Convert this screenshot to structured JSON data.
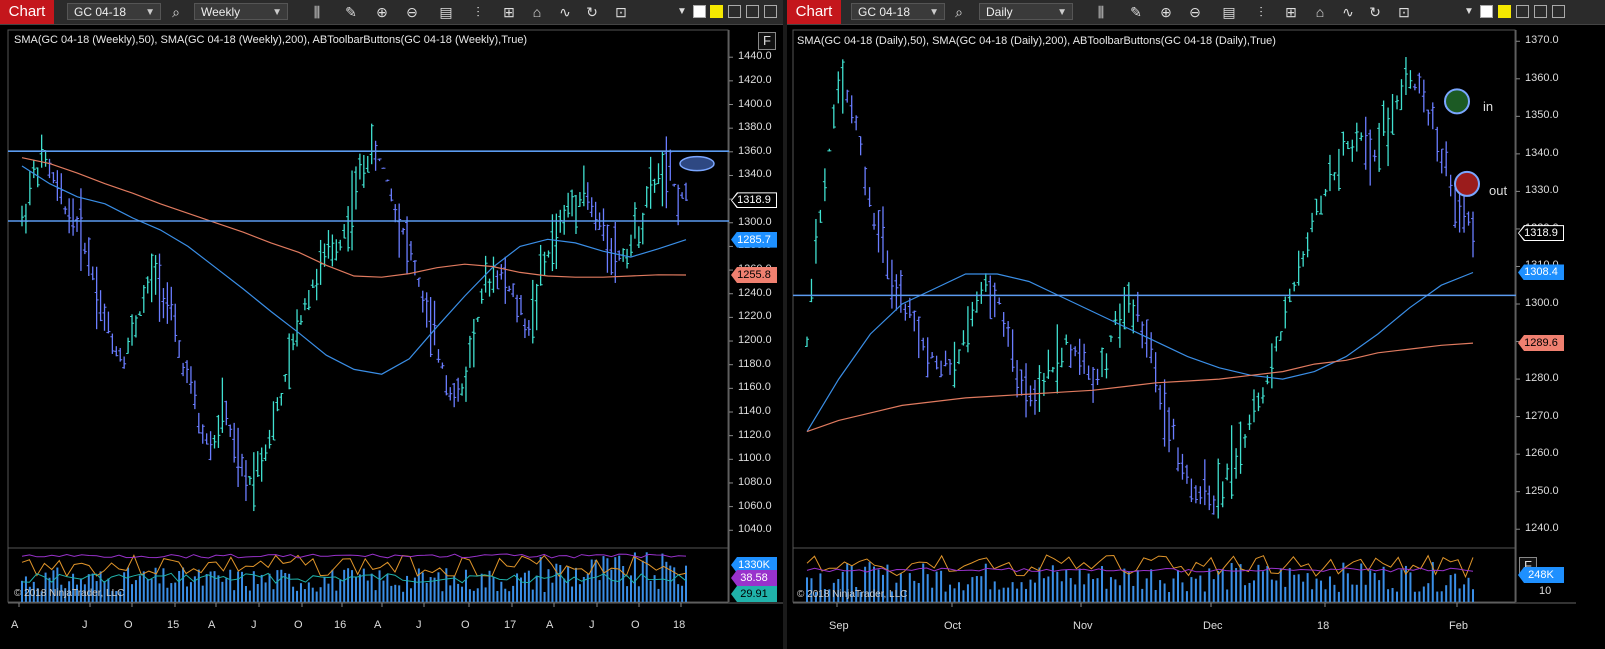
{
  "windows": [
    {
      "tab_label": "Chart",
      "instrument": "GC 04-18",
      "interval": "Weekly",
      "indicator_line": "SMA(GC 04-18 (Weekly),50), SMA(GC 04-18 (Weekly),200), ABToolbarButtons(GC 04-18 (Weekly),True)",
      "copyright": "© 2018 NinjaTrader, LLC",
      "f_label": "F",
      "price_ticks": [
        "1440.0",
        "1420.0",
        "1400.0",
        "1380.0",
        "1360.0",
        "1340.0",
        "1320.0",
        "1300.0",
        "1280.0",
        "1260.0",
        "1240.0",
        "1220.0",
        "1200.0",
        "1180.0",
        "1160.0",
        "1140.0",
        "1120.0",
        "1100.0",
        "1080.0",
        "1060.0",
        "1040.0"
      ],
      "date_ticks": [
        "A",
        "J",
        "O",
        "15",
        "A",
        "J",
        "O",
        "16",
        "A",
        "J",
        "O",
        "17",
        "A",
        "J",
        "O",
        "18"
      ],
      "price_badges": [
        {
          "text": "1318.9",
          "value": 1318.9,
          "bg": "#000000",
          "fg": "#ffffff",
          "border": "#ffffff"
        },
        {
          "text": "1285.7",
          "value": 1285.7,
          "bg": "#1e90ff",
          "fg": "#ffffff",
          "border": "#1e90ff"
        },
        {
          "text": "1255.8",
          "value": 1255.8,
          "bg": "#f08070",
          "fg": "#000000",
          "border": "#f08070"
        }
      ],
      "volume_badges": [
        {
          "text": "1330K",
          "bg": "#1e90ff",
          "fg": "#ffffff"
        },
        {
          "text": "38.58",
          "bg": "#9932cc",
          "fg": "#ffffff"
        },
        {
          "text": "29.91",
          "bg": "#20b2aa",
          "fg": "#000000"
        }
      ]
    },
    {
      "tab_label": "Chart",
      "instrument": "GC 04-18",
      "interval": "Daily",
      "indicator_line": "SMA(GC 04-18 (Daily),50), SMA(GC 04-18 (Daily),200), ABToolbarButtons(GC 04-18 (Daily),True)",
      "copyright": "© 2018 NinjaTrader, LLC",
      "f_label": "F",
      "price_ticks": [
        "1370.0",
        "1360.0",
        "1350.0",
        "1340.0",
        "1330.0",
        "1320.0",
        "1310.0",
        "1300.0",
        "1290.0",
        "1280.0",
        "1270.0",
        "1260.0",
        "1250.0",
        "1240.0"
      ],
      "date_ticks": [
        "Sep",
        "Oct",
        "Nov",
        "Dec",
        "18",
        "Feb"
      ],
      "price_badges": [
        {
          "text": "1318.9",
          "value": 1318.9,
          "bg": "#000000",
          "fg": "#ffffff",
          "border": "#ffffff"
        },
        {
          "text": "1308.4",
          "value": 1308.4,
          "bg": "#1e90ff",
          "fg": "#ffffff",
          "border": "#1e90ff"
        },
        {
          "text": "1289.6",
          "value": 1289.6,
          "bg": "#f08070",
          "fg": "#000000",
          "border": "#f08070"
        }
      ],
      "volume_badges": [
        {
          "text": "248K",
          "bg": "#1e90ff",
          "fg": "#ffffff"
        }
      ],
      "volume_tick": "10",
      "annotations": {
        "in": "in",
        "out": "out"
      }
    }
  ],
  "chart_data": [
    {
      "type": "line",
      "title": "GC 04-18 Weekly",
      "ylim": [
        1025,
        1463
      ],
      "horizontal_lines": [
        1360.5,
        1301.5
      ],
      "last_price": 1318.9,
      "series": [
        {
          "name": "SMA 50",
          "color": "#3a8ee6",
          "y": [
            1348,
            1333,
            1322,
            1316,
            1304,
            1294,
            1280,
            1262,
            1244,
            1225,
            1207,
            1188,
            1176,
            1172,
            1185,
            1212,
            1238,
            1262,
            1280,
            1286,
            1283,
            1276,
            1271,
            1278,
            1285.7
          ]
        },
        {
          "name": "SMA 200",
          "color": "#e07a5f",
          "y": [
            1355,
            1350,
            1342,
            1333,
            1325,
            1316,
            1308,
            1300,
            1292,
            1283,
            1275,
            1264,
            1255,
            1254,
            1257,
            1262,
            1265,
            1263,
            1258,
            1255,
            1254,
            1254,
            1255,
            1256,
            1255.8
          ]
        }
      ],
      "price_path": [
        1300,
        1340,
        1355,
        1330,
        1310,
        1300,
        1270,
        1230,
        1200,
        1185,
        1210,
        1240,
        1260,
        1230,
        1190,
        1160,
        1120,
        1110,
        1145,
        1100,
        1080,
        1095,
        1120,
        1150,
        1190,
        1230,
        1250,
        1270,
        1280,
        1300,
        1340,
        1360,
        1350,
        1320,
        1290,
        1260,
        1220,
        1190,
        1160,
        1150,
        1200,
        1240,
        1260,
        1250,
        1230,
        1210,
        1250,
        1280,
        1300,
        1320,
        1330,
        1300,
        1290,
        1270,
        1280,
        1300,
        1330,
        1345,
        1330,
        1318.9
      ]
    },
    {
      "type": "line",
      "title": "GC 04-18 Daily",
      "ylim": [
        1235,
        1373
      ],
      "horizontal_lines": [
        1302.3
      ],
      "markers": [
        {
          "label": "in",
          "y": 1354,
          "color": "#1c5a24"
        },
        {
          "label": "out",
          "y": 1332,
          "color": "#9b1c1c"
        }
      ],
      "last_price": 1318.9,
      "series": [
        {
          "name": "SMA 50",
          "color": "#3a8ee6",
          "y": [
            1266,
            1280,
            1292,
            1300,
            1304,
            1308,
            1308,
            1306,
            1302,
            1298,
            1294,
            1290,
            1286,
            1283,
            1281,
            1280,
            1282,
            1286,
            1292,
            1299,
            1305,
            1308.4
          ]
        },
        {
          "name": "SMA 200",
          "color": "#e07a5f",
          "y": [
            1266,
            1269,
            1271,
            1273,
            1274,
            1275,
            1275.5,
            1276,
            1276.5,
            1277,
            1278,
            1279,
            1279.5,
            1280,
            1281,
            1282,
            1284,
            1285,
            1287,
            1288,
            1289,
            1289.6
          ]
        }
      ],
      "price_path": [
        1290,
        1330,
        1360,
        1350,
        1325,
        1310,
        1300,
        1290,
        1285,
        1282,
        1295,
        1305,
        1300,
        1280,
        1275,
        1282,
        1290,
        1285,
        1280,
        1295,
        1300,
        1290,
        1270,
        1260,
        1250,
        1245,
        1255,
        1265,
        1275,
        1290,
        1305,
        1320,
        1330,
        1340,
        1345,
        1340,
        1350,
        1360,
        1355,
        1340,
        1330,
        1318.9
      ]
    }
  ]
}
